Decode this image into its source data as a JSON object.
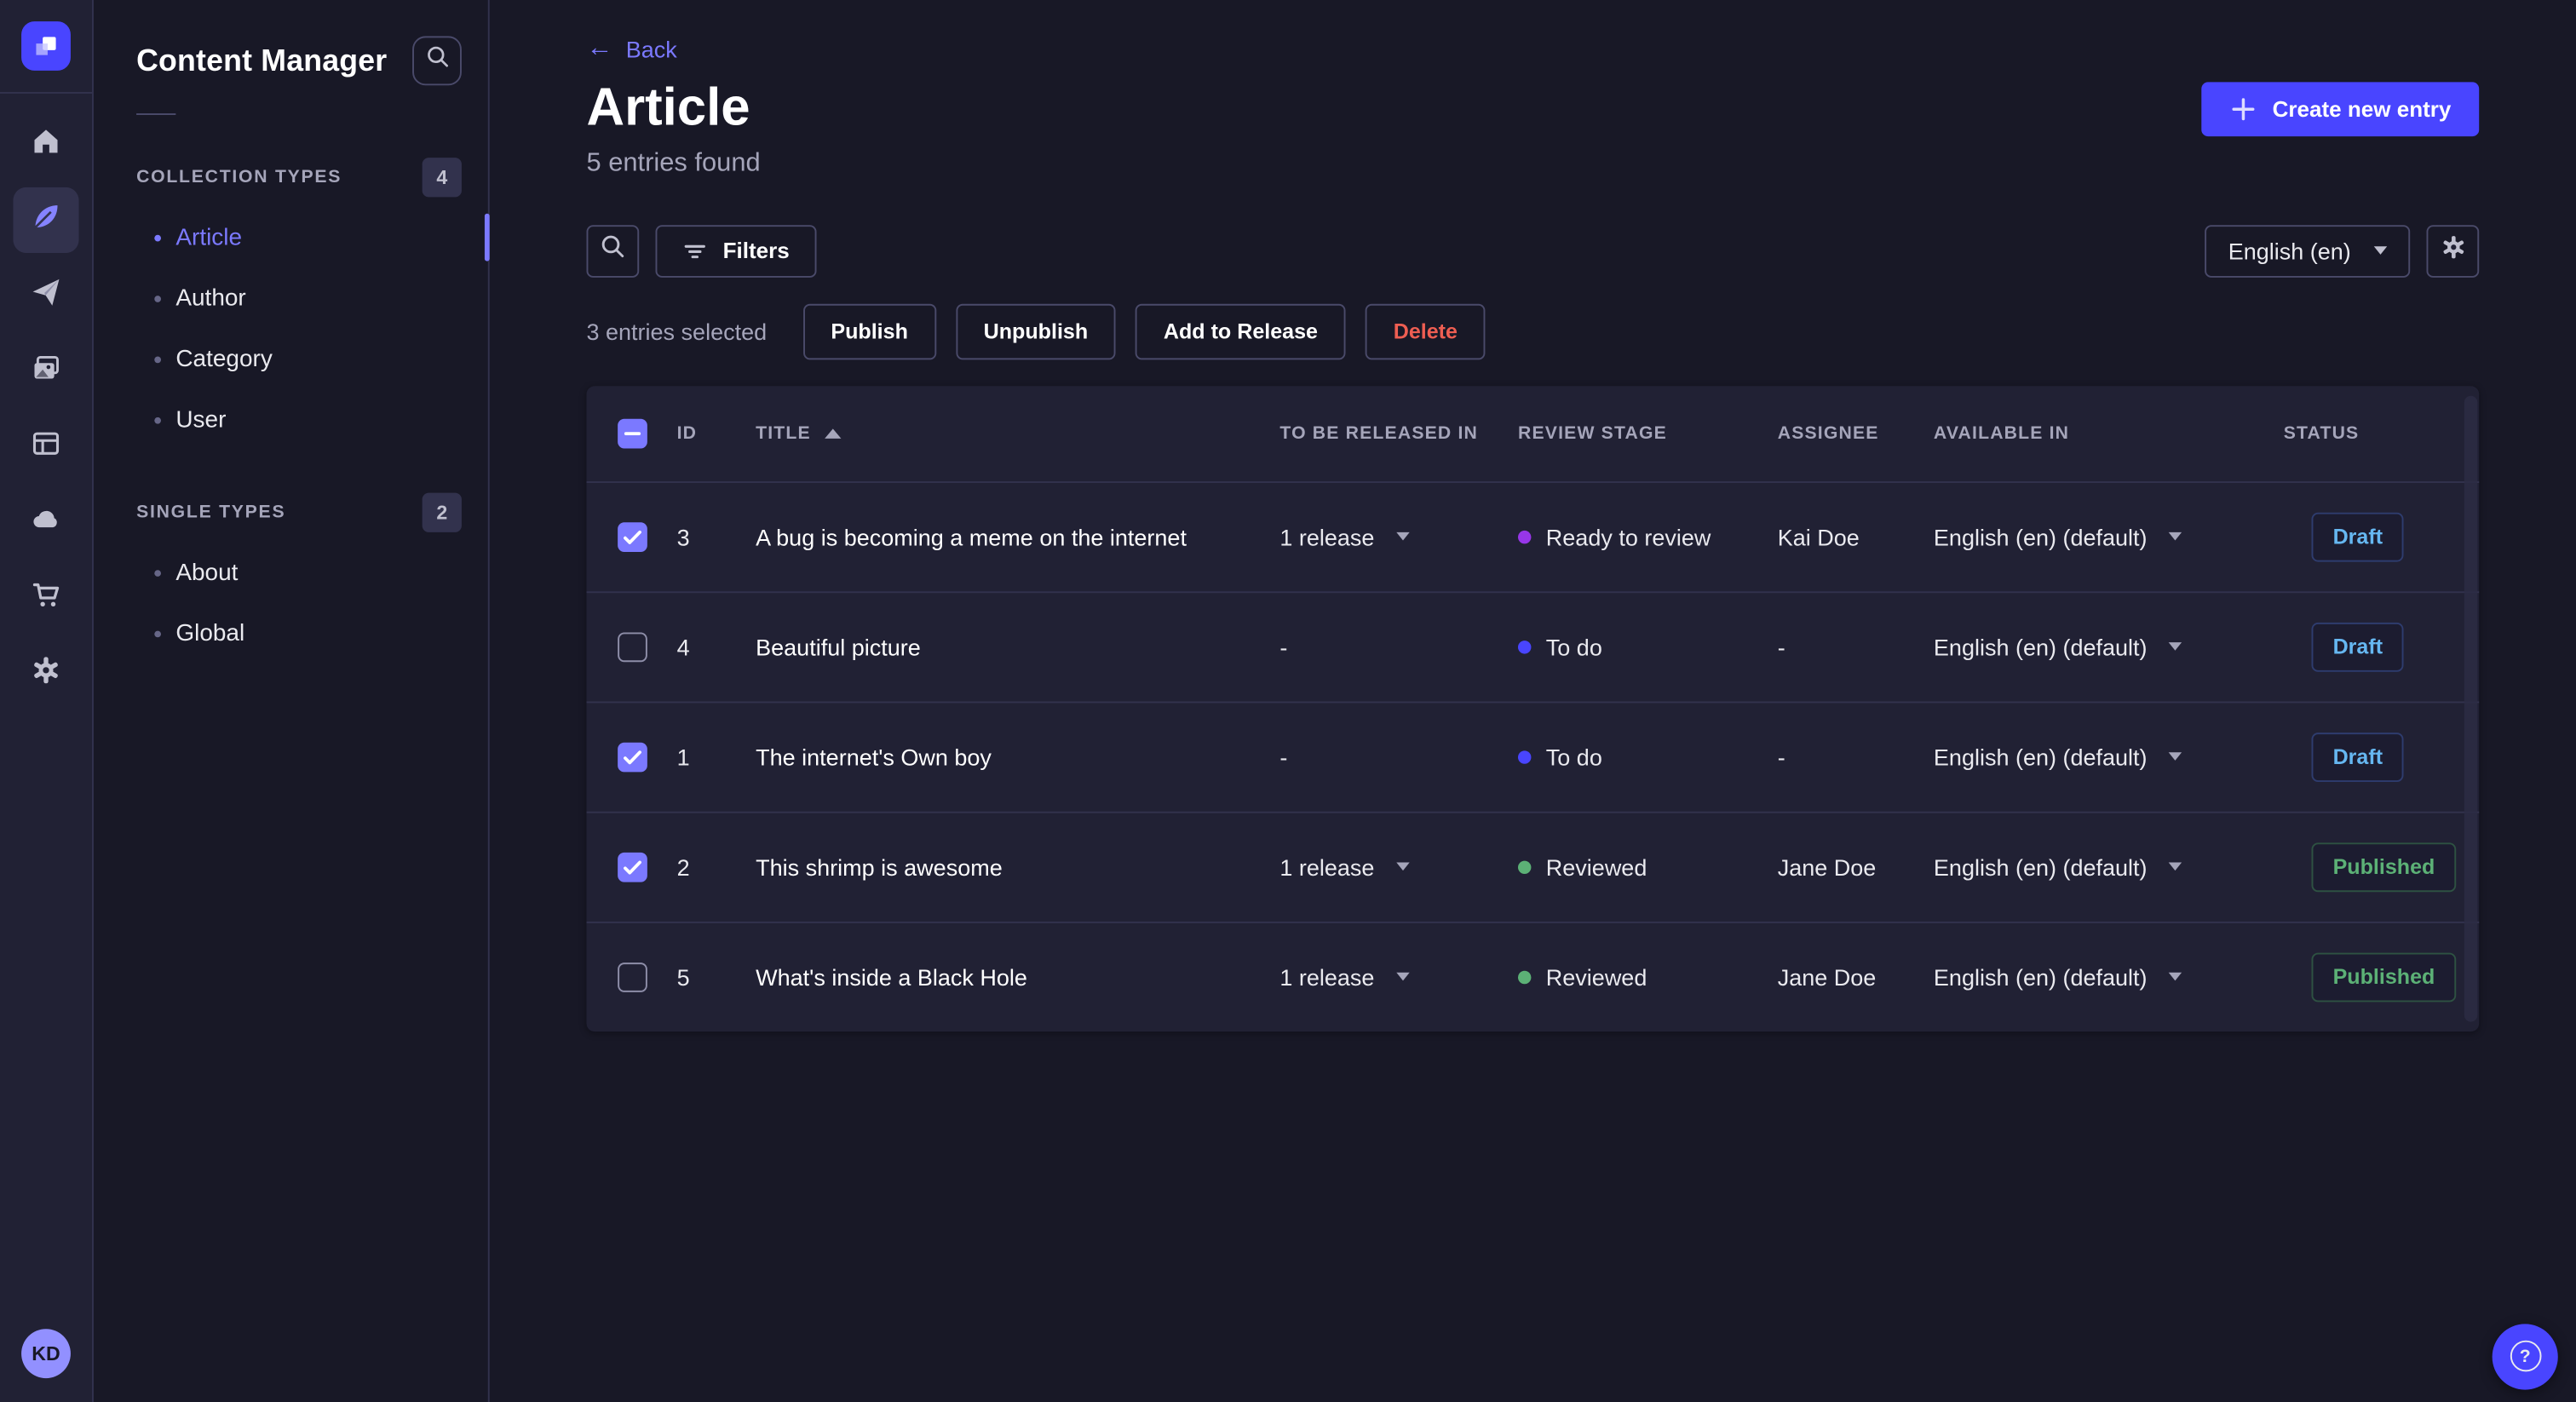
{
  "app": {
    "rail_icons": [
      "strapi-logo",
      "home-icon",
      "content-manager-icon",
      "releases-icon",
      "media-library-icon",
      "content-type-builder-icon",
      "deploy-cloud-icon",
      "marketplace-icon",
      "settings-icon"
    ],
    "avatar_initials": "KD",
    "help_label": "?"
  },
  "sidebar": {
    "title": "Content Manager",
    "sections": [
      {
        "label": "COLLECTION TYPES",
        "count": "4",
        "items": [
          {
            "label": "Article",
            "active": true
          },
          {
            "label": "Author",
            "active": false
          },
          {
            "label": "Category",
            "active": false
          },
          {
            "label": "User",
            "active": false
          }
        ]
      },
      {
        "label": "SINGLE TYPES",
        "count": "2",
        "items": [
          {
            "label": "About",
            "active": false
          },
          {
            "label": "Global",
            "active": false
          }
        ]
      }
    ]
  },
  "header": {
    "back_label": "Back",
    "back_arrow": "←",
    "title": "Article",
    "subtitle": "5 entries found",
    "create_button_label": "Create new entry"
  },
  "toolbar": {
    "filters_label": "Filters",
    "locale_value": "English (en)"
  },
  "selection": {
    "text": "3 entries selected",
    "publish_label": "Publish",
    "unpublish_label": "Unpublish",
    "add_to_release_label": "Add to Release",
    "delete_label": "Delete"
  },
  "table": {
    "columns": [
      "ID",
      "TITLE",
      "TO BE RELEASED IN",
      "REVIEW STAGE",
      "ASSIGNEE",
      "AVAILABLE IN",
      "STATUS"
    ],
    "sorted_column": "TITLE",
    "sort_direction": "asc",
    "rows": [
      {
        "checked": true,
        "id": "3",
        "title": "A bug is becoming a meme on the internet",
        "released_in": "1 release",
        "review_stage": "Ready to review",
        "review_color": "#9736e8",
        "assignee": "Kai Doe",
        "available_in": "English (en) (default)",
        "status": "Draft"
      },
      {
        "checked": false,
        "id": "4",
        "title": "Beautiful picture",
        "released_in": "-",
        "review_stage": "To do",
        "review_color": "#4945ff",
        "assignee": "-",
        "available_in": "English (en) (default)",
        "status": "Draft"
      },
      {
        "checked": true,
        "id": "1",
        "title": "The internet's Own boy",
        "released_in": "-",
        "review_stage": "To do",
        "review_color": "#4945ff",
        "assignee": "-",
        "available_in": "English (en) (default)",
        "status": "Draft"
      },
      {
        "checked": true,
        "id": "2",
        "title": "This shrimp is awesome",
        "released_in": "1 release",
        "review_stage": "Reviewed",
        "review_color": "#5cb176",
        "assignee": "Jane Doe",
        "available_in": "English (en) (default)",
        "status": "Published"
      },
      {
        "checked": false,
        "id": "5",
        "title": "What's inside a Black Hole",
        "released_in": "1 release",
        "review_stage": "Reviewed",
        "review_color": "#5cb176",
        "assignee": "Jane Doe",
        "available_in": "English (en) (default)",
        "status": "Published"
      }
    ]
  },
  "colors": {
    "accent": "#4945ff",
    "accent_light": "#7b79ff",
    "draft_text": "#66b7f1",
    "published_text": "#5cb176",
    "delete_text": "#ee5e52",
    "background": "#181826",
    "panel": "#212134",
    "border": "#32324d"
  }
}
